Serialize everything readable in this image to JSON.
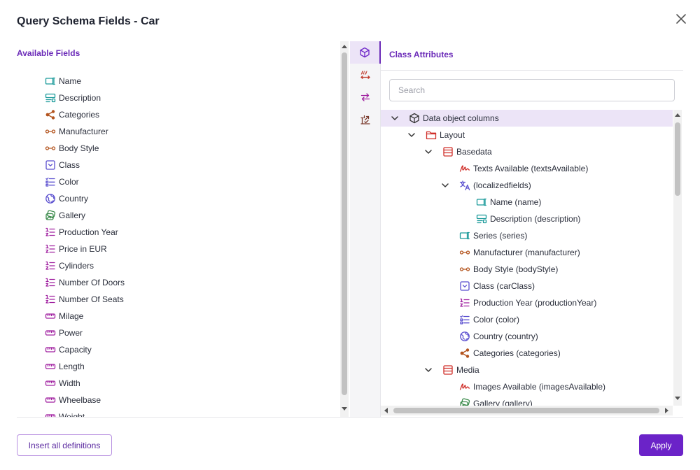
{
  "dialog": {
    "title": "Query Schema Fields - Car",
    "close_icon": "close-icon"
  },
  "available_fields": {
    "title": "Available Fields",
    "items": [
      {
        "label": "Name",
        "icon": "input-icon",
        "color": "#1a9a9a"
      },
      {
        "label": "Description",
        "icon": "textarea-icon",
        "color": "#1a9a9a"
      },
      {
        "label": "Categories",
        "icon": "relation-icon",
        "color": "#b3541e"
      },
      {
        "label": "Manufacturer",
        "icon": "link-icon",
        "color": "#b3541e"
      },
      {
        "label": "Body Style",
        "icon": "link-icon",
        "color": "#b3541e"
      },
      {
        "label": "Class",
        "icon": "select-icon",
        "color": "#5a4fcf"
      },
      {
        "label": "Color",
        "icon": "multiselect-icon",
        "color": "#5a4fcf"
      },
      {
        "label": "Country",
        "icon": "country-icon",
        "color": "#5a4fcf"
      },
      {
        "label": "Gallery",
        "icon": "gallery-icon",
        "color": "#3a8a4a"
      },
      {
        "label": "Production Year",
        "icon": "numeric-icon",
        "color": "#a020a0"
      },
      {
        "label": "Price in EUR",
        "icon": "numeric-icon",
        "color": "#a020a0"
      },
      {
        "label": "Cylinders",
        "icon": "numeric-icon",
        "color": "#a020a0"
      },
      {
        "label": "Number Of Doors",
        "icon": "numeric-icon",
        "color": "#a020a0"
      },
      {
        "label": "Number Of Seats",
        "icon": "numeric-icon",
        "color": "#a020a0"
      },
      {
        "label": "Milage",
        "icon": "quantity-icon",
        "color": "#a020a0"
      },
      {
        "label": "Power",
        "icon": "quantity-icon",
        "color": "#a020a0"
      },
      {
        "label": "Capacity",
        "icon": "quantity-icon",
        "color": "#a020a0"
      },
      {
        "label": "Length",
        "icon": "quantity-icon",
        "color": "#a020a0"
      },
      {
        "label": "Width",
        "icon": "quantity-icon",
        "color": "#a020a0"
      },
      {
        "label": "Wheelbase",
        "icon": "quantity-icon",
        "color": "#a020a0"
      },
      {
        "label": "Weight",
        "icon": "quantity-icon",
        "color": "#a020a0"
      }
    ]
  },
  "side_tabs": [
    {
      "name": "class-attributes-tab",
      "icon": "cube-icon",
      "active": true
    },
    {
      "name": "system-columns-tab",
      "icon": "av-icon",
      "active": false
    },
    {
      "name": "relations-tab",
      "icon": "swap-icon",
      "active": false
    },
    {
      "name": "operators-tab",
      "icon": "transform-icon",
      "active": false
    }
  ],
  "class_attributes": {
    "title": "Class Attributes",
    "search_placeholder": "Search",
    "tree": [
      {
        "label": "Data object columns",
        "icon": "cube-icon",
        "depth": 0,
        "expanded": true,
        "selected": true
      },
      {
        "label": "Layout",
        "icon": "folder-icon",
        "depth": 1,
        "expanded": true
      },
      {
        "label": "Basedata",
        "icon": "panel-icon",
        "depth": 2,
        "expanded": true
      },
      {
        "label": "Texts Available (textsAvailable)",
        "icon": "signature-icon",
        "depth": 3
      },
      {
        "label": "(localizedfields)",
        "icon": "translate-icon",
        "depth": 3,
        "expanded": true
      },
      {
        "label": "Name (name)",
        "icon": "input-icon",
        "depth": 4
      },
      {
        "label": "Description (description)",
        "icon": "textarea-icon",
        "depth": 4
      },
      {
        "label": "Series (series)",
        "icon": "input-icon",
        "depth": 3
      },
      {
        "label": "Manufacturer (manufacturer)",
        "icon": "link-icon",
        "depth": 3
      },
      {
        "label": "Body Style (bodyStyle)",
        "icon": "link-icon",
        "depth": 3
      },
      {
        "label": "Class (carClass)",
        "icon": "select-icon",
        "depth": 3
      },
      {
        "label": "Production Year (productionYear)",
        "icon": "numeric-icon",
        "depth": 3
      },
      {
        "label": "Color (color)",
        "icon": "multiselect-icon",
        "depth": 3
      },
      {
        "label": "Country (country)",
        "icon": "country-icon",
        "depth": 3
      },
      {
        "label": "Categories (categories)",
        "icon": "relation-icon",
        "depth": 3
      },
      {
        "label": "Media",
        "icon": "panel-icon",
        "depth": 2,
        "expanded": true
      },
      {
        "label": "Images Available (imagesAvailable)",
        "icon": "signature-icon",
        "depth": 3
      },
      {
        "label": "Gallery (gallery)",
        "icon": "gallery-icon",
        "depth": 3
      }
    ]
  },
  "footer": {
    "insert_all_label": "Insert all definitions",
    "apply_label": "Apply"
  },
  "colors": {
    "accent": "#6b23c8",
    "selected_bg": "#ece4f7"
  }
}
